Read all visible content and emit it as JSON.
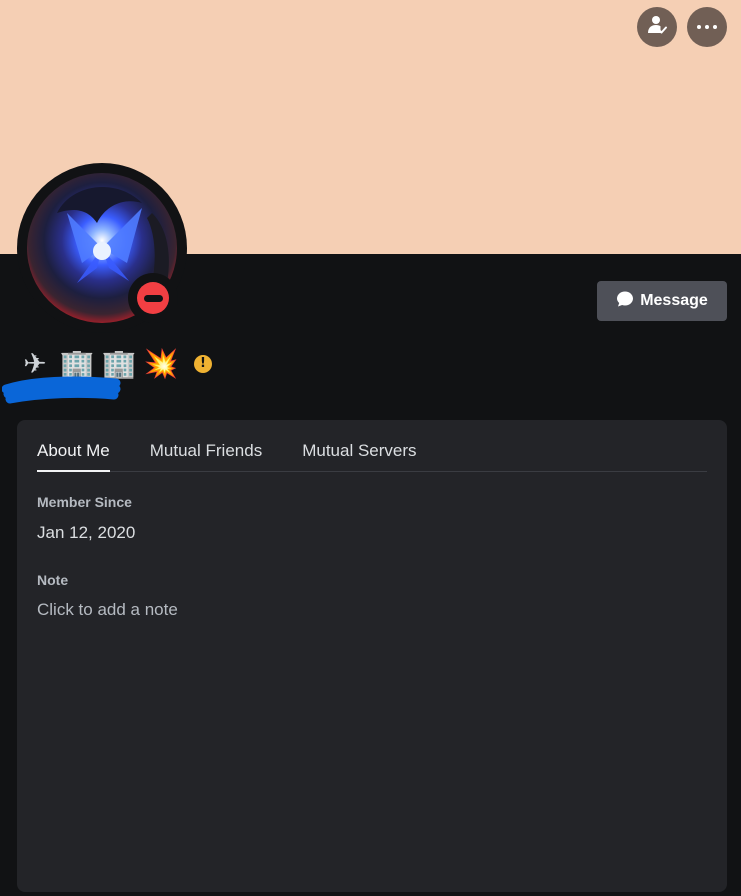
{
  "colors": {
    "banner": "#f5cfb4",
    "background": "#111214",
    "card": "#232428",
    "button": "#4e5058",
    "status_dnd": "#f23f43",
    "warning": "#f0b232",
    "scribble": "#0a66d8"
  },
  "header": {
    "friend_icon": "person-check-icon",
    "more_icon": "ellipsis-icon"
  },
  "user": {
    "status": "do-not-disturb",
    "display_name": "✈🏢🏢💥",
    "emojis": [
      "✈",
      "🏢",
      "🏢",
      "💥"
    ],
    "warning_symbol": "!"
  },
  "actions": {
    "message_label": "Message",
    "message_icon": "chat-bubble-icon"
  },
  "tabs": [
    {
      "label": "About Me",
      "active": true
    },
    {
      "label": "Mutual Friends",
      "active": false
    },
    {
      "label": "Mutual Servers",
      "active": false
    }
  ],
  "about": {
    "member_since_title": "Member Since",
    "member_since_value": "Jan 12, 2020",
    "note_title": "Note",
    "note_placeholder": "Click to add a note"
  }
}
